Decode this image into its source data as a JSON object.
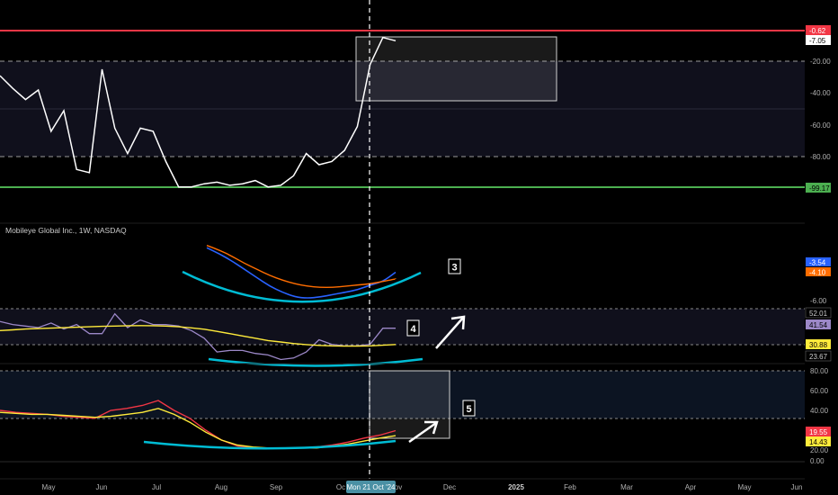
{
  "symbol_header": "Mobileye Global Inc., 1W, NASDAQ",
  "crosshair_date": "Mon 21 Oct '24",
  "colors": {
    "background": "#000000",
    "resistance_line": "#f23645",
    "support_line": "#4caf50",
    "main_series": "#ffffff",
    "blue_series": "#2962ff",
    "orange_series": "#ff6d00",
    "purple_series": "#9c88c8",
    "yellow_series": "#ffeb3b",
    "red_series": "#f23645",
    "cyan_annotation": "#00bcd4",
    "band_fill": "#1a1a2e"
  },
  "main_pane": {
    "axis_labels": [
      "-20.00",
      "-40.00",
      "-60.00",
      "-80.00"
    ],
    "top_level_label": "-0.62",
    "current_label": "-7.05",
    "bottom_level_label": "-99.17",
    "top_level": -0.62,
    "bottom_level": -99.17,
    "dashed_levels": [
      -20,
      -80
    ],
    "band": [
      -20,
      -80
    ]
  },
  "pane2": {
    "label_blue": "-3.54",
    "label_orange": "-4.10",
    "axis_label": "-6.00",
    "annotation_number": "3"
  },
  "pane3": {
    "label_top": "52.01",
    "label_purple": "41.54",
    "label_yellow": "30.88",
    "label_bottom": "23.67",
    "annotation_number": "4"
  },
  "pane4": {
    "axis_labels": [
      "80.00",
      "60.00",
      "40.00",
      "20.00",
      "0.00"
    ],
    "label_red": "19.55",
    "label_yellow": "14.43",
    "annotation_number": "5",
    "dashed_levels": [
      80,
      20
    ]
  },
  "time_axis": [
    "May",
    "Jun",
    "Jul",
    "Aug",
    "Sep",
    "Oc",
    "ov",
    "Dec",
    "2025",
    "Feb",
    "Mar",
    "Apr",
    "May",
    "Jun"
  ],
  "chart_data": [
    {
      "type": "line",
      "title": "",
      "ylim": [
        -100,
        0
      ],
      "series": [
        {
          "values": [
            -29,
            -37,
            -44,
            -38,
            -64,
            -51,
            -88,
            -90,
            -25,
            -62,
            -78,
            -62,
            -64,
            -83,
            -99,
            -99,
            -97,
            -96,
            -98,
            -97,
            -95,
            -99,
            -98,
            -92,
            -78,
            -85,
            -83,
            -76,
            -61,
            -22,
            -5,
            -7
          ]
        }
      ]
    },
    {
      "type": "line",
      "title": "",
      "series": [
        {
          "values": [
            -1.5,
            -2.0,
            -2.6,
            -3.3,
            -4.0,
            -4.7,
            -5.2,
            -5.6,
            -5.7,
            -5.6,
            -5.4,
            -5.2,
            -5.0,
            -4.6,
            -4.3,
            -3.54
          ]
        },
        {
          "values": [
            -1.3,
            -1.7,
            -2.2,
            -2.8,
            -3.3,
            -3.8,
            -4.2,
            -4.5,
            -4.7,
            -4.8,
            -4.8,
            -4.7,
            -4.6,
            -4.5,
            -4.3,
            -4.1
          ]
        }
      ]
    },
    {
      "type": "line",
      "title": "",
      "ylim": [
        18,
        56
      ],
      "series": [
        {
          "values": [
            46,
            44,
            43,
            42,
            45,
            41,
            44,
            38,
            38,
            51,
            42,
            47,
            44,
            44,
            43,
            40,
            35,
            26,
            27,
            27,
            25,
            24,
            21,
            22,
            26,
            34,
            31,
            30,
            30,
            31,
            41.54,
            41.54
          ]
        },
        {
          "values": [
            40,
            40.5,
            41,
            41.3,
            41.6,
            41.9,
            42.2,
            42.5,
            42.8,
            43.0,
            43.2,
            43.3,
            43.2,
            43.0,
            42.5,
            41.8,
            40.9,
            39.5,
            38.0,
            36.5,
            35.0,
            33.5,
            32.5,
            31.5,
            30.8,
            30.3,
            30.0,
            29.8,
            29.8,
            30.0,
            30.4,
            30.88
          ]
        }
      ]
    },
    {
      "type": "line",
      "title": "",
      "ylim": [
        -10,
        90
      ],
      "series": [
        {
          "values": [
            40,
            38,
            37,
            36,
            34,
            33,
            32,
            40,
            42,
            45,
            50,
            40,
            32,
            20,
            10,
            4,
            2,
            2,
            2,
            2,
            3,
            5,
            8,
            12,
            15,
            19.55
          ]
        },
        {
          "values": [
            38,
            37,
            36,
            36,
            35,
            34,
            33,
            34,
            36,
            38,
            42,
            36,
            28,
            18,
            10,
            5,
            3,
            2,
            2,
            2,
            2,
            4,
            6,
            9,
            12,
            14.43
          ]
        }
      ]
    }
  ]
}
